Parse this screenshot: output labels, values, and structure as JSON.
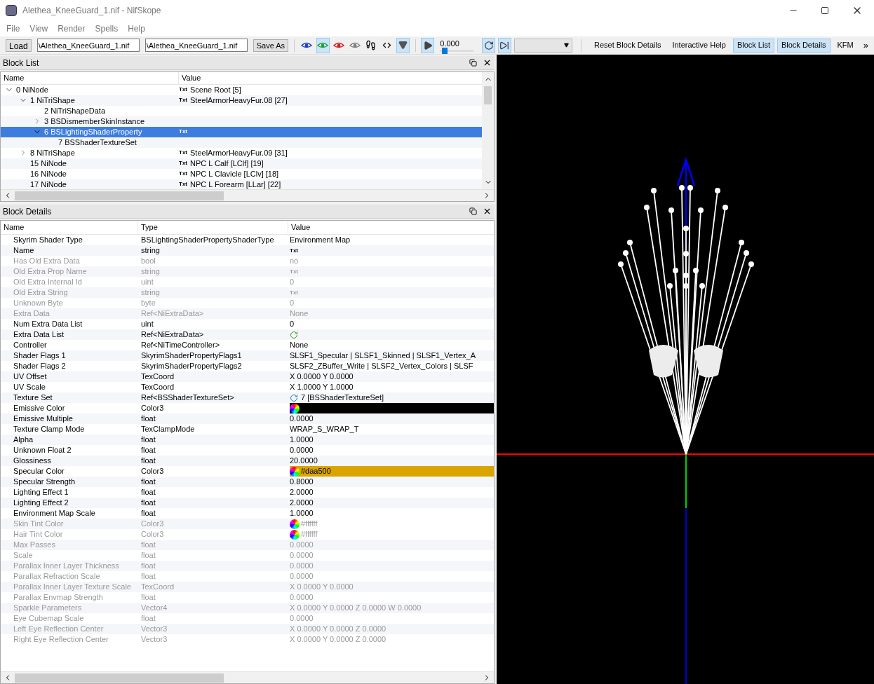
{
  "window": {
    "title": "Alethea_KneeGuard_1.nif - NifSkope"
  },
  "menu": [
    "File",
    "View",
    "Render",
    "Spells",
    "Help"
  ],
  "toolbar": {
    "load": "Load",
    "file_fields": [
      {
        "value": "\\Alethea_KneeGuard_1.nif"
      },
      {
        "value": "\\Alethea_KneeGuard_1.nif"
      }
    ],
    "save_as": "Save As",
    "view_tools": [
      {
        "kind": "eye",
        "color": "#2040c0",
        "selected": false
      },
      {
        "kind": "eye",
        "color": "#20a040",
        "selected": true
      },
      {
        "kind": "eye",
        "color": "#d02020",
        "selected": false
      },
      {
        "kind": "eye",
        "color": "#808080",
        "selected": false
      },
      {
        "kind": "feet",
        "selected": false
      },
      {
        "kind": "axes",
        "selected": false
      },
      {
        "kind": "down",
        "selected": true
      }
    ],
    "play": {
      "selected": true
    },
    "time": "0.000",
    "time_slider": {
      "level": 0.05
    },
    "loop": {
      "selected": true
    },
    "step": {
      "selected": true
    },
    "actions": [
      {
        "label": "Reset Block Details",
        "selected": false
      },
      {
        "label": "Interactive Help",
        "selected": false
      },
      {
        "label": "Block List",
        "selected": true
      },
      {
        "label": "Block Details",
        "selected": true
      },
      {
        "label": "KFM",
        "selected": false
      }
    ],
    "overflow": "»"
  },
  "block_list": {
    "title": "Block List",
    "columns": [
      "Name",
      "Value"
    ],
    "tree": [
      {
        "label": "0 NiNode",
        "tag": "Txt",
        "value": "Scene Root [5]",
        "expanded": true,
        "selected": false,
        "children": [
          {
            "label": "1 NiTriShape",
            "tag": "Txt",
            "value": "SteelArmorHeavyFur.08 [27]",
            "expanded": true,
            "selected": false,
            "children": [
              {
                "label": "2 NiTriShapeData",
                "selected": false
              },
              {
                "label": "3 BSDismemberSkinInstance",
                "expanded": false,
                "selected": false
              },
              {
                "label": "6 BSLightingShaderProperty",
                "tag": "Txt",
                "expanded": true,
                "selected": true,
                "children": [
                  {
                    "label": "7 BSShaderTextureSet",
                    "selected": false
                  }
                ]
              }
            ]
          },
          {
            "label": "8 NiTriShape",
            "tag": "Txt",
            "value": "SteelArmorHeavyFur.09 [31]",
            "expanded": false,
            "selected": false
          },
          {
            "label": "15 NiNode",
            "tag": "Txt",
            "value": "NPC L Calf [LClf] [19]",
            "selected": false
          },
          {
            "label": "16 NiNode",
            "tag": "Txt",
            "value": "NPC L Clavicle [LClv] [18]",
            "selected": false
          },
          {
            "label": "17 NiNode",
            "tag": "Txt",
            "value": "NPC L Forearm [LLar] [22]",
            "selected": false
          }
        ]
      }
    ]
  },
  "block_details": {
    "title": "Block Details",
    "columns": [
      "Name",
      "Type",
      "Value"
    ],
    "rows": [
      {
        "name": "Skyrim Shader Type",
        "type": "BSLightingShaderPropertyShaderType",
        "kind": "text",
        "value": "Environment Map",
        "disabled": false
      },
      {
        "name": "Name",
        "type": "string",
        "kind": "txt",
        "value": "Txt",
        "disabled": false
      },
      {
        "name": "Has Old Extra Data",
        "type": "bool",
        "kind": "text",
        "value": "no",
        "disabled": true
      },
      {
        "name": "Old Extra Prop Name",
        "type": "string",
        "kind": "txt",
        "value": "Txt",
        "disabled": true
      },
      {
        "name": "Old Extra Internal Id",
        "type": "uint",
        "kind": "text",
        "value": "0",
        "disabled": true
      },
      {
        "name": "Old Extra String",
        "type": "string",
        "kind": "txt",
        "value": "Txt",
        "disabled": true
      },
      {
        "name": "Unknown Byte",
        "type": "byte",
        "kind": "text",
        "value": "0",
        "disabled": true
      },
      {
        "name": "Extra Data",
        "type": "Ref<NiExtraData>",
        "kind": "text",
        "value": "None",
        "disabled": true
      },
      {
        "name": "Num Extra Data List",
        "type": "uint",
        "kind": "text",
        "value": "0",
        "disabled": false
      },
      {
        "name": "Extra Data List",
        "type": "Ref<NiExtraData>",
        "kind": "list",
        "disabled": false
      },
      {
        "name": "Controller",
        "type": "Ref<NiTimeController>",
        "kind": "text",
        "value": "None",
        "disabled": false
      },
      {
        "name": "Shader Flags 1",
        "type": "SkyrimShaderPropertyFlags1",
        "kind": "text",
        "value": "SLSF1_Specular | SLSF1_Skinned | SLSF1_Vertex_A",
        "disabled": false
      },
      {
        "name": "Shader Flags 2",
        "type": "SkyrimShaderPropertyFlags2",
        "kind": "text",
        "value": "SLSF2_ZBuffer_Write | SLSF2_Vertex_Colors | SLSF",
        "disabled": false
      },
      {
        "name": "UV Offset",
        "type": "TexCoord",
        "kind": "text",
        "value": "X 0.0000 Y 0.0000",
        "disabled": false
      },
      {
        "name": "UV Scale",
        "type": "TexCoord",
        "kind": "text",
        "value": "X 1.0000 Y 1.0000",
        "disabled": false
      },
      {
        "name": "Texture Set",
        "type": "Ref<BSShaderTextureSet>",
        "kind": "ref",
        "value": "7 [BSShaderTextureSet]",
        "disabled": false
      },
      {
        "name": "Emissive Color",
        "type": "Color3",
        "kind": "color",
        "color": "#000000",
        "disabled": false
      },
      {
        "name": "Emissive Multiple",
        "type": "float",
        "kind": "text",
        "value": "0.0000",
        "disabled": false
      },
      {
        "name": "Texture Clamp Mode",
        "type": "TexClampMode",
        "kind": "text",
        "value": "WRAP_S_WRAP_T",
        "disabled": false
      },
      {
        "name": "Alpha",
        "type": "float",
        "kind": "text",
        "value": "1.0000",
        "disabled": false
      },
      {
        "name": "Unknown Float 2",
        "type": "float",
        "kind": "text",
        "value": "0.0000",
        "disabled": false
      },
      {
        "name": "Glossiness",
        "type": "float",
        "kind": "text",
        "value": "20.0000",
        "disabled": false
      },
      {
        "name": "Specular Color",
        "type": "Color3",
        "kind": "color",
        "color": "#daa500",
        "value": "#daa500",
        "disabled": false
      },
      {
        "name": "Specular Strength",
        "type": "float",
        "kind": "text",
        "value": "0.8000",
        "disabled": false
      },
      {
        "name": "Lighting Effect 1",
        "type": "float",
        "kind": "text",
        "value": "2.0000",
        "disabled": false
      },
      {
        "name": "Lighting Effect 2",
        "type": "float",
        "kind": "text",
        "value": "2.0000",
        "disabled": false
      },
      {
        "name": "Environment Map Scale",
        "type": "float",
        "kind": "text",
        "value": "1.0000",
        "disabled": false
      },
      {
        "name": "Skin Tint Color",
        "type": "Color3",
        "kind": "color",
        "color": "#ffffff",
        "value": "#ffffff",
        "disabled": true
      },
      {
        "name": "Hair Tint Color",
        "type": "Color3",
        "kind": "color",
        "color": "#ffffff",
        "value": "#ffffff",
        "disabled": true
      },
      {
        "name": "Max Passes",
        "type": "float",
        "kind": "text",
        "value": "0.0000",
        "disabled": true
      },
      {
        "name": "Scale",
        "type": "float",
        "kind": "text",
        "value": "0.0000",
        "disabled": true
      },
      {
        "name": "Parallax Inner Layer Thickness",
        "type": "float",
        "kind": "text",
        "value": "0.0000",
        "disabled": true
      },
      {
        "name": "Parallax Refraction Scale",
        "type": "float",
        "kind": "text",
        "value": "0.0000",
        "disabled": true
      },
      {
        "name": "Parallax Inner Layer Texture Scale",
        "type": "TexCoord",
        "kind": "text",
        "value": "X 0.0000 Y 0.0000",
        "disabled": true
      },
      {
        "name": "Parallax Envmap Strength",
        "type": "float",
        "kind": "text",
        "value": "0.0000",
        "disabled": true
      },
      {
        "name": "Sparkle Parameters",
        "type": "Vector4",
        "kind": "text",
        "value": "X 0.0000 Y 0.0000 Z 0.0000 W 0.0000",
        "disabled": true
      },
      {
        "name": "Eye Cubemap Scale",
        "type": "float",
        "kind": "text",
        "value": "0.0000",
        "disabled": true
      },
      {
        "name": "Left Eye Reflection Center",
        "type": "Vector3",
        "kind": "text",
        "value": "X 0.0000 Y 0.0000 Z 0.0000",
        "disabled": true
      },
      {
        "name": "Right Eye Reflection Center",
        "type": "Vector3",
        "kind": "text",
        "value": "X 0.0000 Y 0.0000 Z 0.0000",
        "disabled": true
      }
    ]
  }
}
